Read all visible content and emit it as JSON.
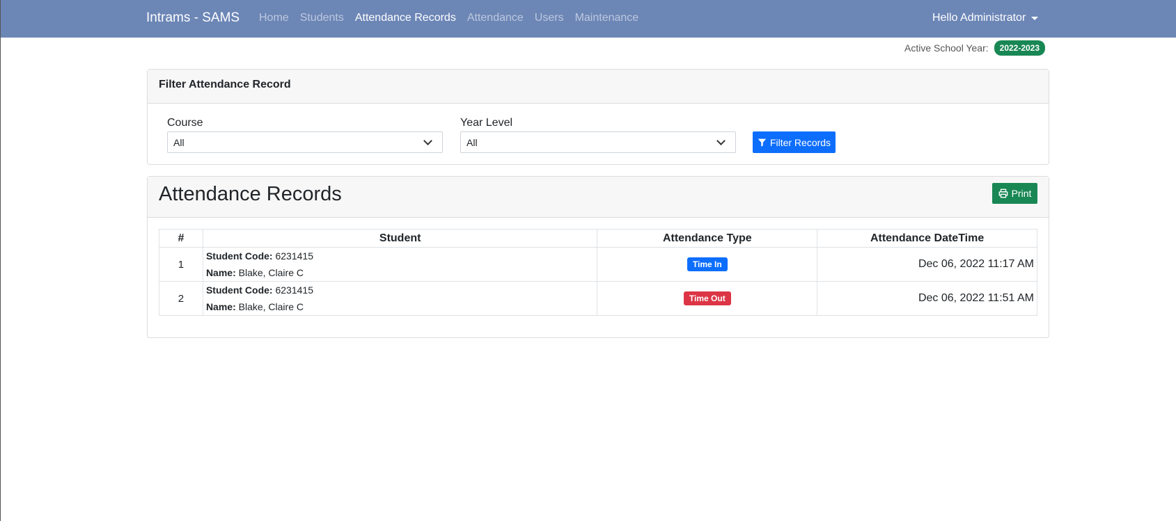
{
  "navbar": {
    "brand": "Intrams - SAMS",
    "links": [
      {
        "label": "Home",
        "active": false
      },
      {
        "label": "Students",
        "active": false
      },
      {
        "label": "Attendance Records",
        "active": true
      },
      {
        "label": "Attendance",
        "active": false
      },
      {
        "label": "Users",
        "active": false
      },
      {
        "label": "Maintenance",
        "active": false
      }
    ],
    "user_menu": "Hello Administrator",
    "bg_color": "#6c86b6"
  },
  "school_year": {
    "label": "Active School Year:",
    "value": "2022-2023"
  },
  "filter_card": {
    "title": "Filter Attendance Record",
    "course": {
      "label": "Course",
      "selected": "All"
    },
    "year_level": {
      "label": "Year Level",
      "selected": "All"
    },
    "filter_button": "Filter Records"
  },
  "records_card": {
    "title": "Attendance Records",
    "print_button": "Print",
    "columns": [
      "#",
      "Student",
      "Attendance Type",
      "Attendance DateTime"
    ],
    "code_label": "Student Code:",
    "name_label": "Name:",
    "rows": [
      {
        "num": "1",
        "code": "6231415",
        "name": "Blake, Claire C",
        "type": "Time In",
        "type_color": "#0d6efd",
        "datetime": "Dec 06, 2022 11:17 AM"
      },
      {
        "num": "2",
        "code": "6231415",
        "name": "Blake, Claire C",
        "type": "Time Out",
        "type_color": "#dc3545",
        "datetime": "Dec 06, 2022 11:51 AM"
      }
    ]
  }
}
